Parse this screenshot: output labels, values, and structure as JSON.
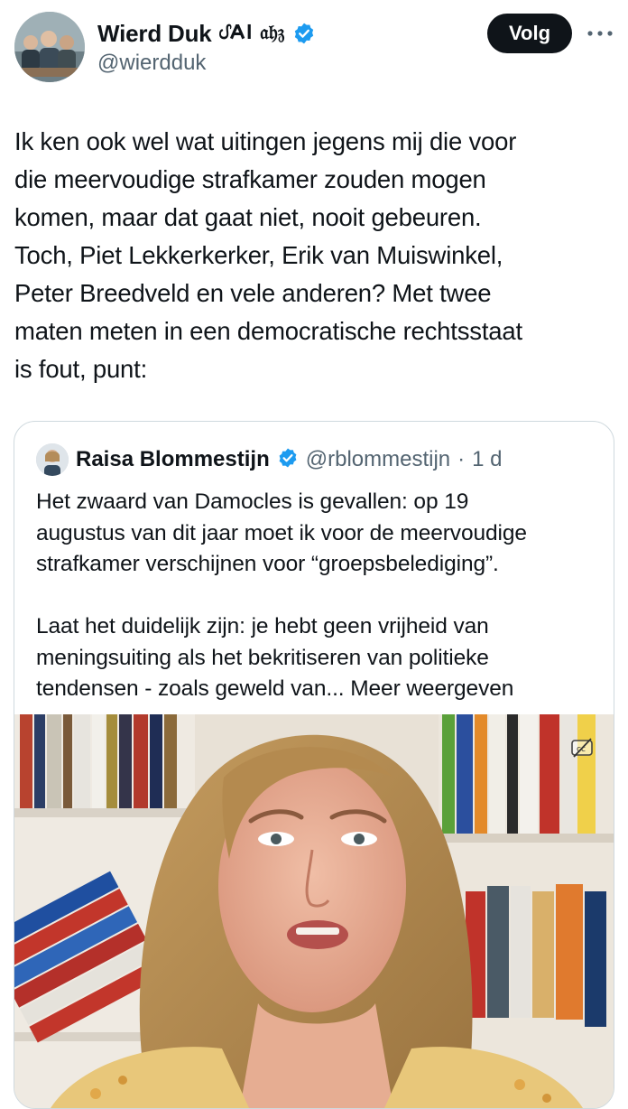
{
  "author": {
    "name": "Wierd Duk",
    "name_suffix": "ᦔ𐌀𐌉 𝔞𝔥𝔷",
    "handle": "@wierdduk",
    "verified": true
  },
  "actions": {
    "follow_label": "Volg",
    "more_icon": "more-horizontal-icon"
  },
  "tweet": {
    "lines": [
      "Ik ken ook wel wat uitingen jegens mij die voor",
      "die meervoudige strafkamer zouden mogen",
      "komen, maar dat gaat niet, nooit gebeuren.",
      "Toch, Piet Lekkerkerker, Erik van Muiswinkel,",
      "Peter Breedveld en vele anderen? Met twee",
      "maten meten in een democratische rechtsstaat",
      "is fout, punt:"
    ]
  },
  "quoted": {
    "name": "Raisa Blommestijn",
    "handle": "@rblommestijn",
    "separator": "·",
    "time": "1 d",
    "paragraph1": [
      "Het zwaard van Damocles is gevallen: op 19",
      "augustus van dit jaar moet ik voor de meervoudige",
      "strafkamer verschijnen voor “groepsbelediging”."
    ],
    "paragraph2": [
      "Laat het duidelijk zijn: je hebt geen vrijheid van",
      "meningsuiting als het bekritiseren van politieke",
      "tendensen - zoals geweld van..."
    ],
    "show_more": "Meer weergeven",
    "media_badge_icon": "hide-caption-icon"
  },
  "colors": {
    "text": "#0f1419",
    "secondary": "#536471",
    "verified": "#1d9bf0",
    "border": "#cfd9de",
    "button_bg": "#0f1419"
  }
}
